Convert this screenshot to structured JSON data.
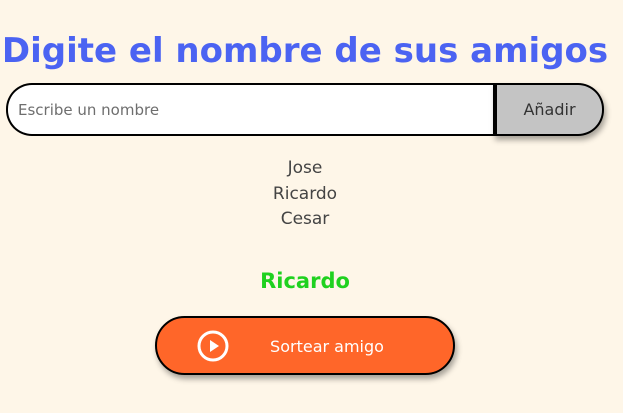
{
  "header": {
    "title": "Digite el nombre de sus amigos"
  },
  "form": {
    "placeholder": "Escribe un nombre",
    "value": "",
    "add_label": "Añadir"
  },
  "friends": [
    "Jose",
    "Ricardo",
    "Cesar"
  ],
  "result": {
    "text": "Ricardo"
  },
  "draw_button": {
    "label": "Sortear amigo",
    "icon": "play-circle-icon"
  },
  "colors": {
    "background": "#fef6e8",
    "title": "#4b63f2",
    "result": "#1fd11f",
    "draw_button": "#ff6629",
    "add_button": "#c4c4c4"
  }
}
